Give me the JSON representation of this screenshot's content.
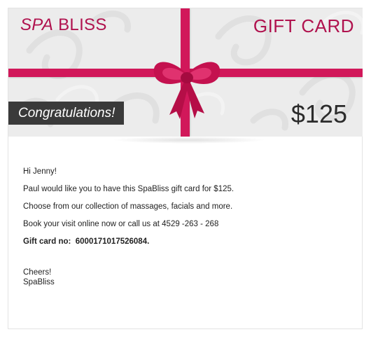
{
  "header": {
    "brand_spa": "SPA",
    "brand_bliss": "BLISS",
    "title": "GIFT CARD",
    "congrats": "Congratulations!",
    "amount": "$125"
  },
  "message": {
    "greeting": "Hi Jenny!",
    "line1": "Paul would like you to have this SpaBliss gift card for $125.",
    "line2": "Choose from our collection of massages, facials and more.",
    "line3": "Book your visit online now or call us at 4529 -263 - 268",
    "card_label": "Gift card no:",
    "card_number": "6000171017526084.",
    "signoff": "Cheers!",
    "signature": "SpaBliss"
  },
  "colors": {
    "ribbon": "#d1185a",
    "brand": "#b0124e",
    "banner": "#3a3a3a"
  },
  "icons": {
    "bow": "ribbon-bow-icon"
  }
}
